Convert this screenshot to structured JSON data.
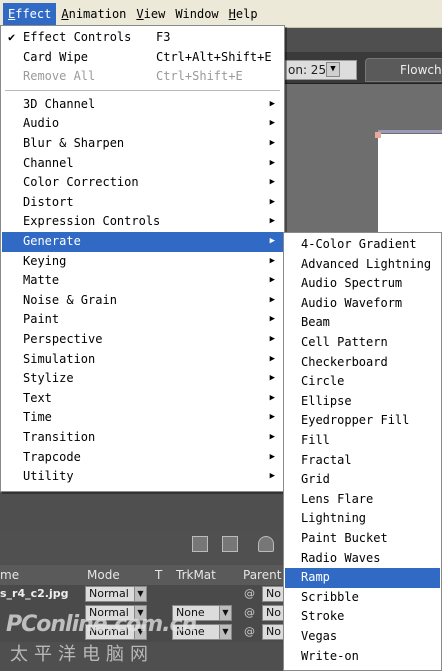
{
  "menubar": [
    "Effect",
    "Animation",
    "View",
    "Window",
    "Help"
  ],
  "menubar_underline": [
    "E",
    "A",
    "V",
    "",
    "H"
  ],
  "effect_top": [
    {
      "label": "Effect Controls",
      "shortcut": "F3",
      "checked": true,
      "disabled": false
    },
    {
      "label": "Card Wipe",
      "shortcut": "Ctrl+Alt+Shift+E",
      "checked": false,
      "disabled": false
    },
    {
      "label": "Remove All",
      "shortcut": "Ctrl+Shift+E",
      "checked": false,
      "disabled": true
    }
  ],
  "effect_categories": [
    "3D Channel",
    "Audio",
    "Blur & Sharpen",
    "Channel",
    "Color Correction",
    "Distort",
    "Expression Controls",
    "Generate",
    "Keying",
    "Matte",
    "Noise & Grain",
    "Paint",
    "Perspective",
    "Simulation",
    "Stylize",
    "Text",
    "Time",
    "Transition",
    "Trapcode",
    "Utility"
  ],
  "highlighted_category": "Generate",
  "generate_items": [
    "4-Color Gradient",
    "Advanced Lightning",
    "Audio Spectrum",
    "Audio Waveform",
    "Beam",
    "Cell Pattern",
    "Checkerboard",
    "Circle",
    "Ellipse",
    "Eyedropper Fill",
    "Fill",
    "Fractal",
    "Grid",
    "Lens Flare",
    "Lightning",
    "Paint Bucket",
    "Radio Waves",
    "Ramp",
    "Scribble",
    "Stroke",
    "Vegas",
    "Write-on"
  ],
  "highlighted_generate": "Ramp",
  "viewer": {
    "zoom": "on: 25",
    "tab": "Flowcha"
  },
  "timeline": {
    "headers": [
      "me",
      "Mode",
      "T",
      "TrkMat",
      "Parent"
    ],
    "rows": [
      {
        "layer": "s_r4_c2.jpg",
        "mode": "Normal",
        "trkmat": "",
        "parent": "No"
      },
      {
        "layer": "",
        "mode": "Normal",
        "trkmat": "None",
        "parent": "No"
      },
      {
        "layer": "",
        "mode": "Normal",
        "trkmat": "None",
        "parent": "No"
      }
    ]
  },
  "watermark": {
    "line1": "PConline.com.cn",
    "line2": "太平洋电脑网"
  },
  "colors": {
    "highlight": "#316ac5",
    "menubar": "#ece9d8",
    "panel": "#4f4f4f"
  }
}
